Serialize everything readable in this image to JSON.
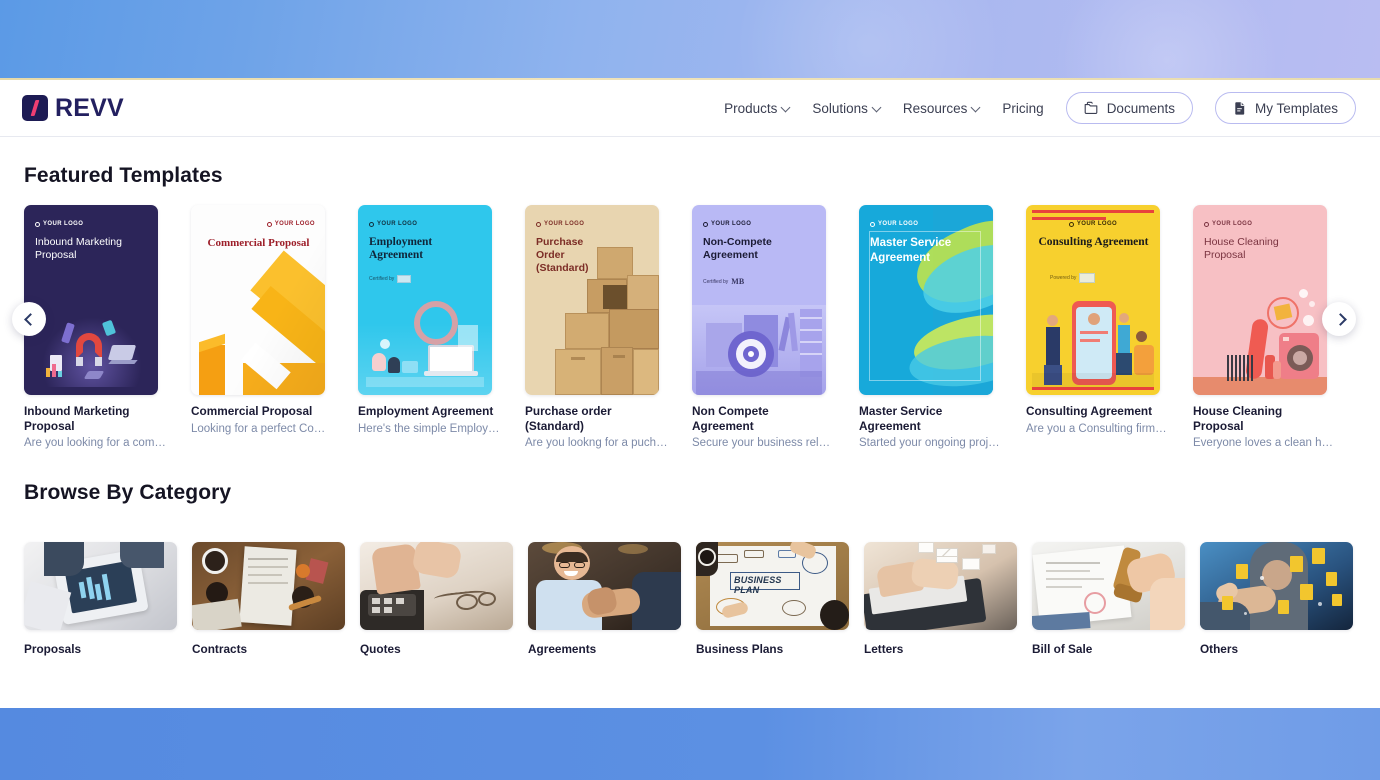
{
  "brand": {
    "name": "REVV",
    "logo_icon": "revv-slash-logo",
    "logo_color": "#1d1b54",
    "accent_color": "#ef3e72"
  },
  "nav": {
    "items": [
      {
        "label": "Products",
        "has_dropdown": true
      },
      {
        "label": "Solutions",
        "has_dropdown": true
      },
      {
        "label": "Resources",
        "has_dropdown": true
      },
      {
        "label": "Pricing",
        "has_dropdown": false
      }
    ],
    "buttons": [
      {
        "label": "Documents",
        "icon": "folder-icon"
      },
      {
        "label": "My Templates",
        "icon": "document-icon"
      }
    ]
  },
  "featured": {
    "heading": "Featured Templates",
    "prev_label": "Previous",
    "next_label": "Next",
    "templates": [
      {
        "name": "Inbound Marketing Proposal",
        "desc": "Are you looking for a compr...",
        "cover_title": "Inbound Marketing Proposal",
        "logo_placeholder": "YOUR LOGO",
        "bg": "#2c2559",
        "fg": "#ffffff",
        "certified": ""
      },
      {
        "name": "Commercial Proposal",
        "desc": "Looking for a perfect Comm...",
        "cover_title": "Commercial Proposal",
        "logo_placeholder": "YOUR LOGO",
        "bg": "#fdfdfd",
        "fg": "#9d1f2a",
        "certified": ""
      },
      {
        "name": "Employment Agreement",
        "desc": "Here's the simple Employe...",
        "cover_title": "Employment Agreement",
        "logo_placeholder": "YOUR LOGO",
        "bg": "#2fc7ec",
        "fg": "#10263a",
        "certified": "Certified by"
      },
      {
        "name": "Purchase order (Standard)",
        "desc": "Are you lookng for a pucha...",
        "cover_title": "Purchase Order (Standard)",
        "logo_placeholder": "YOUR LOGO",
        "bg": "#e8d5b0",
        "fg": "#7c2d26",
        "certified": ""
      },
      {
        "name": "Non Compete Agreement",
        "desc": "Secure your business relati...",
        "cover_title": "Non-Compete Agreement",
        "logo_placeholder": "YOUR LOGO",
        "bg": "#b9b9f5",
        "fg": "#1b1b35",
        "certified": "Certified by"
      },
      {
        "name": "Master Service Agreement",
        "desc": "Started your ongoing projec...",
        "cover_title": "Master Service Agreement",
        "logo_placeholder": "YOUR LOGO",
        "bg": "#17a9da",
        "fg": "#ffffff",
        "certified": ""
      },
      {
        "name": "Consulting Agreement",
        "desc": "Are you a Consulting firm lo...",
        "cover_title": "Consulting Agreement",
        "logo_placeholder": "YOUR LOGO",
        "bg": "#f7d02e",
        "fg": "#1b1b1b",
        "certified": "Powered by"
      },
      {
        "name": "House Cleaning Proposal",
        "desc": "Everyone loves a clean hou...",
        "cover_title": "House Cleaning Proposal",
        "logo_placeholder": "YOUR LOGO",
        "bg": "#f7c0c4",
        "fg": "#7a3340",
        "certified": ""
      }
    ]
  },
  "browse": {
    "heading": "Browse By Category",
    "categories": [
      {
        "label": "Proposals",
        "image_alt": "hand-using-tablet-with-business-charts"
      },
      {
        "label": "Contracts",
        "image_alt": "contract-papers-on-wooden-desk"
      },
      {
        "label": "Quotes",
        "image_alt": "hands-using-calculator-with-glasses"
      },
      {
        "label": "Agreements",
        "image_alt": "two-men-shaking-hands-smiling"
      },
      {
        "label": "Business Plans",
        "image_alt": "business-plan-whiteboard-diagram"
      },
      {
        "label": "Letters",
        "image_alt": "hands-typing-on-laptop-with-mail-icons"
      },
      {
        "label": "Bill of Sale",
        "image_alt": "hand-stamping-document-with-seal"
      },
      {
        "label": "Others",
        "image_alt": "finger-touching-floating-document-icons"
      }
    ]
  }
}
